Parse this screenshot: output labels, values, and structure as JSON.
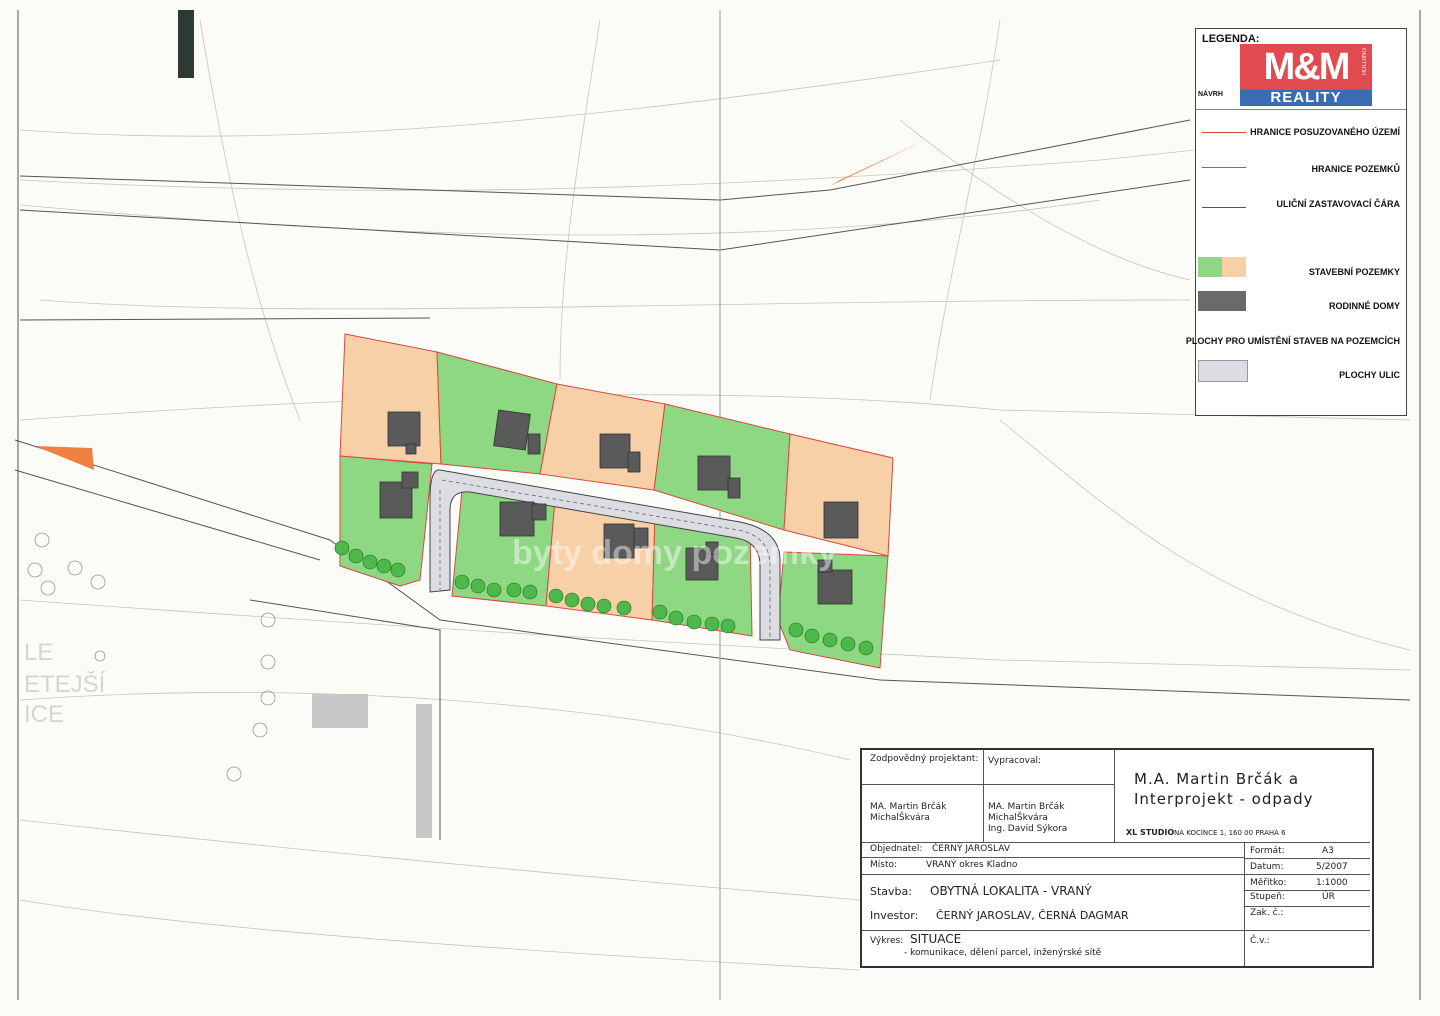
{
  "legend": {
    "title": "LEGENDA:",
    "navrh": "NÁVRH",
    "items": [
      {
        "label": "HRANICE POSUZOVANÉHO ÚZEMÍ"
      },
      {
        "label": "HRANICE POZEMKŮ"
      },
      {
        "label": "ULIČNÍ ZASTAVOVACÍ ČÁRA"
      },
      {
        "label": "STAVEBNÍ POZEMKY"
      },
      {
        "label": "RODINNÉ DOMY"
      },
      {
        "label": "PLOCHY PRO UMÍSTĚNÍ STAVEB NA POZEMCÍCH"
      },
      {
        "label": "PLOCHY ULIC"
      }
    ]
  },
  "logo": {
    "top": "M&M",
    "bottom": "REALITY",
    "tag": "HOLDING"
  },
  "watermark": "byty domy pozemky",
  "map_labels": {
    "left_text": [
      "LE",
      "ETEJŠÍ",
      "ICE"
    ]
  },
  "title_block": {
    "zodpovedny_label": "Zodpovědný projektant:",
    "zodpovedny_names": [
      "MA. Martin Brčák",
      "MichalŠkvára"
    ],
    "vypracoval_label": "Vypracoval:",
    "vypracoval_names": [
      "MA. Martin Brčák",
      "MichalŠkvára",
      "Ing. David Sýkora"
    ],
    "company": [
      "M.A. Martin Brčák a",
      "Interprojekt - odpady"
    ],
    "studio": "XL STUDIO",
    "studio_address": "NA KOCÍNCE 1, 160 00 PRAHA 6",
    "objednatel_label": "Objednatel:",
    "objednatel": "ČERNÝ JAROSLAV",
    "misto_label": "Místo:",
    "misto": "VRANÝ okres Kladno",
    "stavba_label": "Stavba:",
    "stavba": "OBYTNÁ LOKALITA - VRANÝ",
    "investor_label": "Investor:",
    "investor": "ČERNÝ JAROSLAV, ČERNÁ DAGMAR",
    "vykres_label": "Výkres:",
    "vykres": "SITUACE",
    "vykres_sub": "- komunikace, dělení parcel, inženýrské sítě",
    "format_label": "Formát:",
    "format": "A3",
    "datum_label": "Datum:",
    "datum": "5/2007",
    "meritko_label": "Měřítko:",
    "meritko": "1:1000",
    "stupen_label": "Stupeň:",
    "stupen": "ÚR",
    "zak_label": "Zak. č.:",
    "cv_label": "Č.v.:"
  },
  "colors": {
    "green": "#8fd883",
    "orange": "#f8d0a8",
    "house": "#5a5a5a",
    "boundary": "#d44a3c",
    "street": "#dcdde2"
  }
}
